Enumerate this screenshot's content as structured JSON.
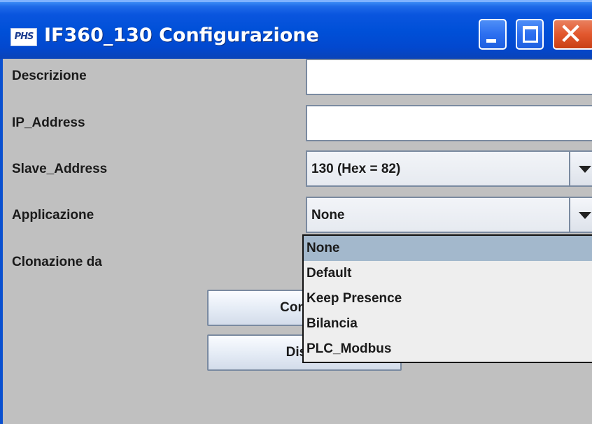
{
  "window": {
    "icon_text": "PHS",
    "title": "IF360_130 Configurazione"
  },
  "form": {
    "descrizione": {
      "label": "Descrizione",
      "value": ""
    },
    "ip_address": {
      "label": "IP_Address",
      "value": ""
    },
    "slave_address": {
      "label": "Slave_Address",
      "value": "130  (Hex = 82)"
    },
    "applicazione": {
      "label": "Applicazione",
      "value": "None"
    },
    "clonazione": {
      "label": "Clonazione da"
    }
  },
  "buttons": {
    "connessione": "Connes",
    "dispositivo": "Dispo"
  },
  "dropdown": {
    "options": [
      "None",
      "Default",
      "Keep Presence",
      "Bilancia",
      "PLC_Modbus"
    ],
    "selected": "None"
  }
}
